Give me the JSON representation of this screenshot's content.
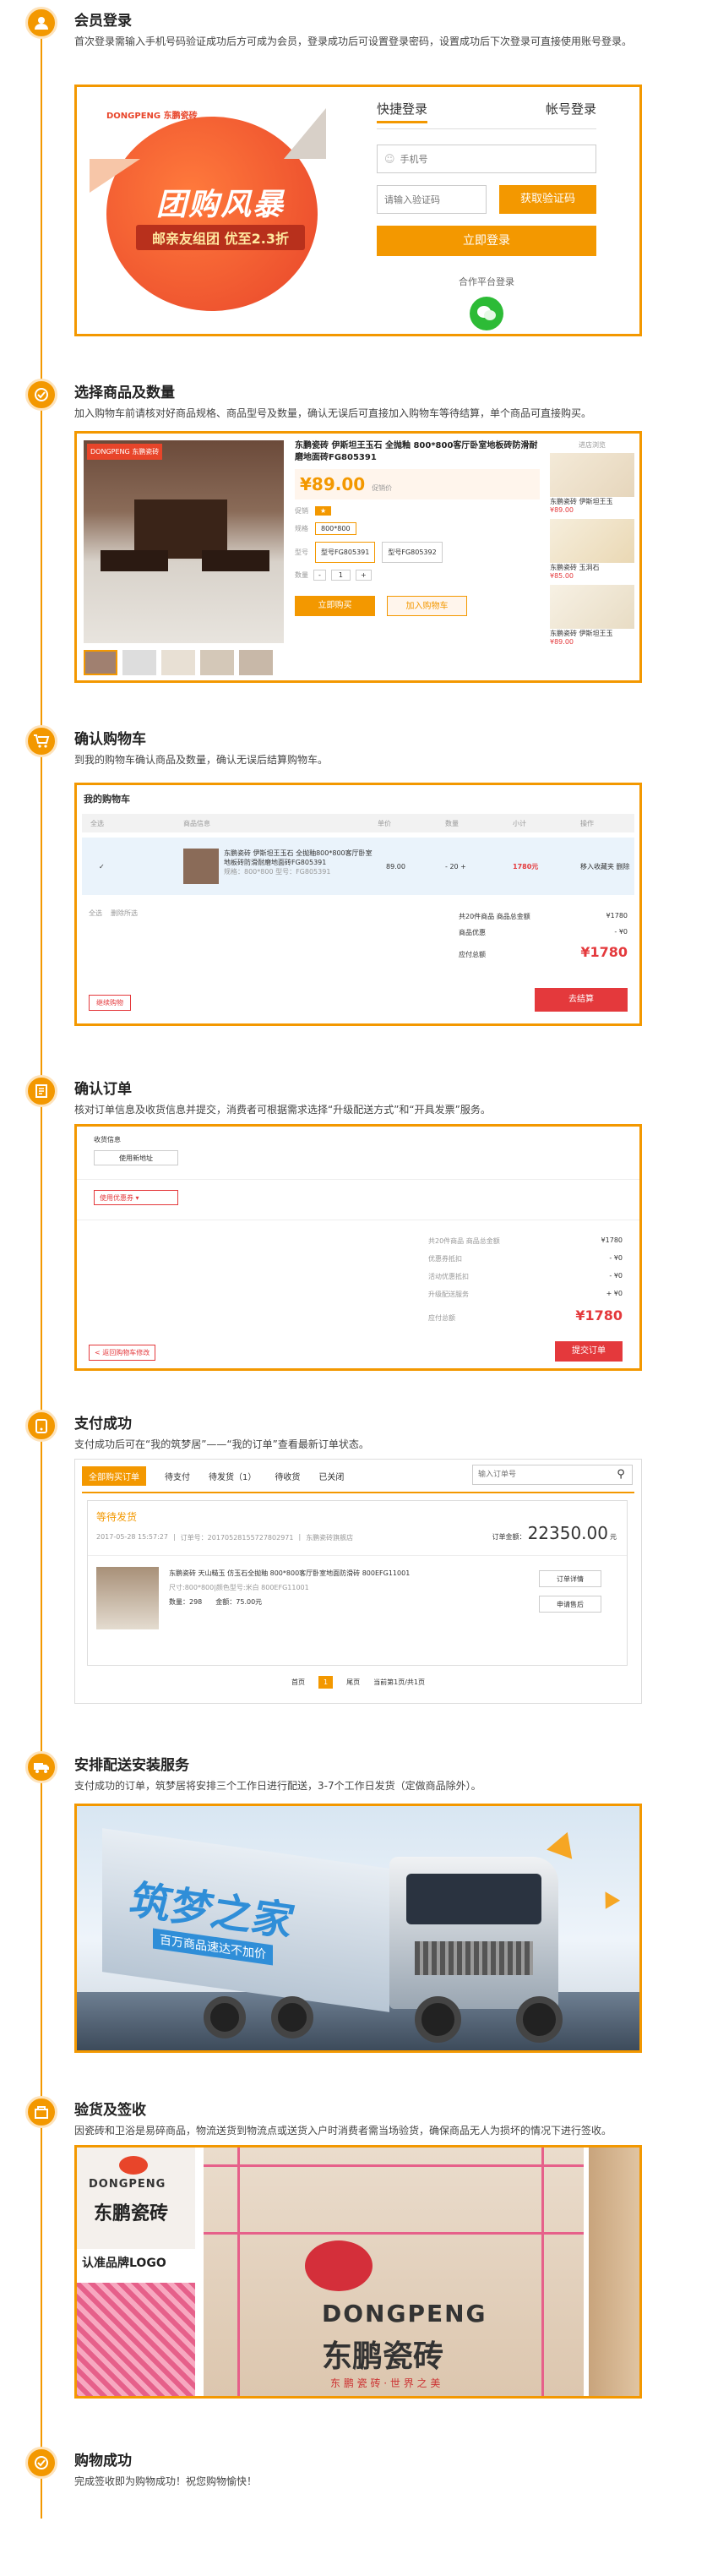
{
  "steps": [
    {
      "title": "会员登录",
      "desc": "首次登录需输入手机号码验证成功后方可成为会员，登录成功后可设置登录密码，设置成功后下次登录可直接使用账号登录。",
      "icon": "user-icon"
    },
    {
      "title": "选择商品及数量",
      "desc": "加入购物车前请核对好商品规格、商品型号及数量，确认无误后可直接加入购物车等待结算，单个商品可直接购买。",
      "icon": "check-icon"
    },
    {
      "title": "确认购物车",
      "desc": "到我的购物车确认商品及数量，确认无误后结算购物车。",
      "icon": "cart-icon"
    },
    {
      "title": "确认订单",
      "desc": "核对订单信息及收货信息并提交，消费者可根据需求选择“升级配送方式”和“开具发票”服务。",
      "icon": "order-icon"
    },
    {
      "title": "支付成功",
      "desc": "支付成功后可在“我的筑梦居”——“我的订单”查看最新订单状态。",
      "icon": "pay-icon"
    },
    {
      "title": "安排配送安装服务",
      "desc": "支付成功的订单，筑梦居将安排三个工作日进行配送，3-7个工作日发货（定做商品除外）。",
      "icon": "truck-icon"
    },
    {
      "title": "验货及签收",
      "desc": "因瓷砖和卫浴是易碎商品，物流送货到物流点或送货入户时消费者需当场验货，确保商品无人为损坏的情况下进行签收。",
      "icon": "inspect-icon"
    },
    {
      "title": "购物成功",
      "desc": "完成签收即为购物成功！祝您购物愉快！",
      "icon": "success-icon"
    }
  ],
  "login": {
    "banner_main": "团购风暴",
    "banner_sub": "邮亲友组团 优至2.3折",
    "tab_quick": "快捷登录",
    "tab_account": "帐号登录",
    "phone_placeholder": "手机号",
    "code_placeholder": "请输入验证码",
    "get_code": "获取验证码",
    "login_btn": "立即登录",
    "partner_label": "合作平台登录",
    "brand": "DONGPENG 东鹏瓷砖"
  },
  "product": {
    "name": "东鹏瓷砖 伊斯坦王玉石 全抛釉 800*800客厅卧室地板砖防滑耐磨地面砖FG805391",
    "price": "¥89.00",
    "price_old": "促销价",
    "promo_label": "促销",
    "spec_label": "规格",
    "spec_value": "800*800",
    "model_label": "型号",
    "model_a": "型号FG805391",
    "model_b": "型号FG805392",
    "qty_label": "数量",
    "qty": "1",
    "buy_now": "立即购买",
    "add_cart": "加入购物车",
    "side_title": "进店浏览",
    "side_items": [
      {
        "name": "东鹏瓷砖 伊斯坦王玉",
        "price": "¥89.00"
      },
      {
        "name": "东鹏瓷砖 玉洞石",
        "price": "¥85.00"
      },
      {
        "name": "东鹏瓷砖 伊斯坦王玉",
        "price": "¥89.00"
      }
    ]
  },
  "cart": {
    "title": "我的购物车",
    "headers": [
      "全选",
      "商品信息",
      "单价",
      "数量",
      "小计",
      "操作"
    ],
    "item_name": "东鹏瓷砖 伊斯坦王玉石 全抛釉800*800客厅卧室地板砖防滑耐磨地面砖FG805391",
    "item_spec": "规格：800*800  型号：FG805391",
    "unit_price": "89.00",
    "qty": "20",
    "subtotal": "1780元",
    "ops": "移入收藏夹 删除",
    "select_all": "全选",
    "delete_selected": "删除所选",
    "total_count_label": "共20件商品 商品总金额",
    "total_amount": "¥1780",
    "discount_label": "商品优惠",
    "discount": "- ¥0",
    "pay_label": "应付总额",
    "pay_amount": "¥1780",
    "continue": "继续购物",
    "checkout": "去结算"
  },
  "confirm": {
    "addr_title": "收货信息",
    "addr_btn": "使用新地址",
    "upgrade_label": "使用优惠券",
    "summary": [
      {
        "label": "共20件商品 商品总金额",
        "value": "¥1780"
      },
      {
        "label": "优惠券抵扣",
        "value": "- ¥0"
      },
      {
        "label": "活动优惠抵扣",
        "value": "- ¥0"
      },
      {
        "label": "升级配送服务",
        "value": "+ ¥0"
      }
    ],
    "pay_label": "应付总额",
    "pay_amount": "¥1780",
    "back": "< 返回购物车修改",
    "submit": "提交订单"
  },
  "orders": {
    "tabs": [
      "全部购买订单",
      "待支付",
      "待发货（1）",
      "待收货",
      "已关闭"
    ],
    "search_placeholder": "输入订单号",
    "status": "等待发货",
    "date": "2017-05-28 15:57:27",
    "order_no_label": "订单号：20170528155727802971",
    "store_label": "东鹏瓷砖旗舰店",
    "total_label": "订单金额：",
    "total_amount": "22350.00",
    "total_unit": "元",
    "item_name": "东鹏瓷砖 天山糙玉 仿玉石全抛釉 800*800客厅卧室地面防滑砖 800EFG11001",
    "item_spec": "尺寸:800*800|颜色型号:米白 800EFG11001",
    "item_qty": "数量：298",
    "item_amount": "金额：75.00元",
    "btn_detail": "订单详情",
    "btn_service": "申请售后",
    "pager": [
      "首页",
      "1",
      "尾页",
      "当前第1页/共1页"
    ]
  },
  "delivery": {
    "truck_text": "筑梦之家",
    "truck_sub": "百万商品速达不加价"
  },
  "inspect": {
    "logo_text": "DONGPENG",
    "brand_cn": "东鹏瓷砖",
    "label_logo": "认准品牌LOGO",
    "slogan": "东 鹏 瓷 砖 · 世 界 之 美"
  }
}
